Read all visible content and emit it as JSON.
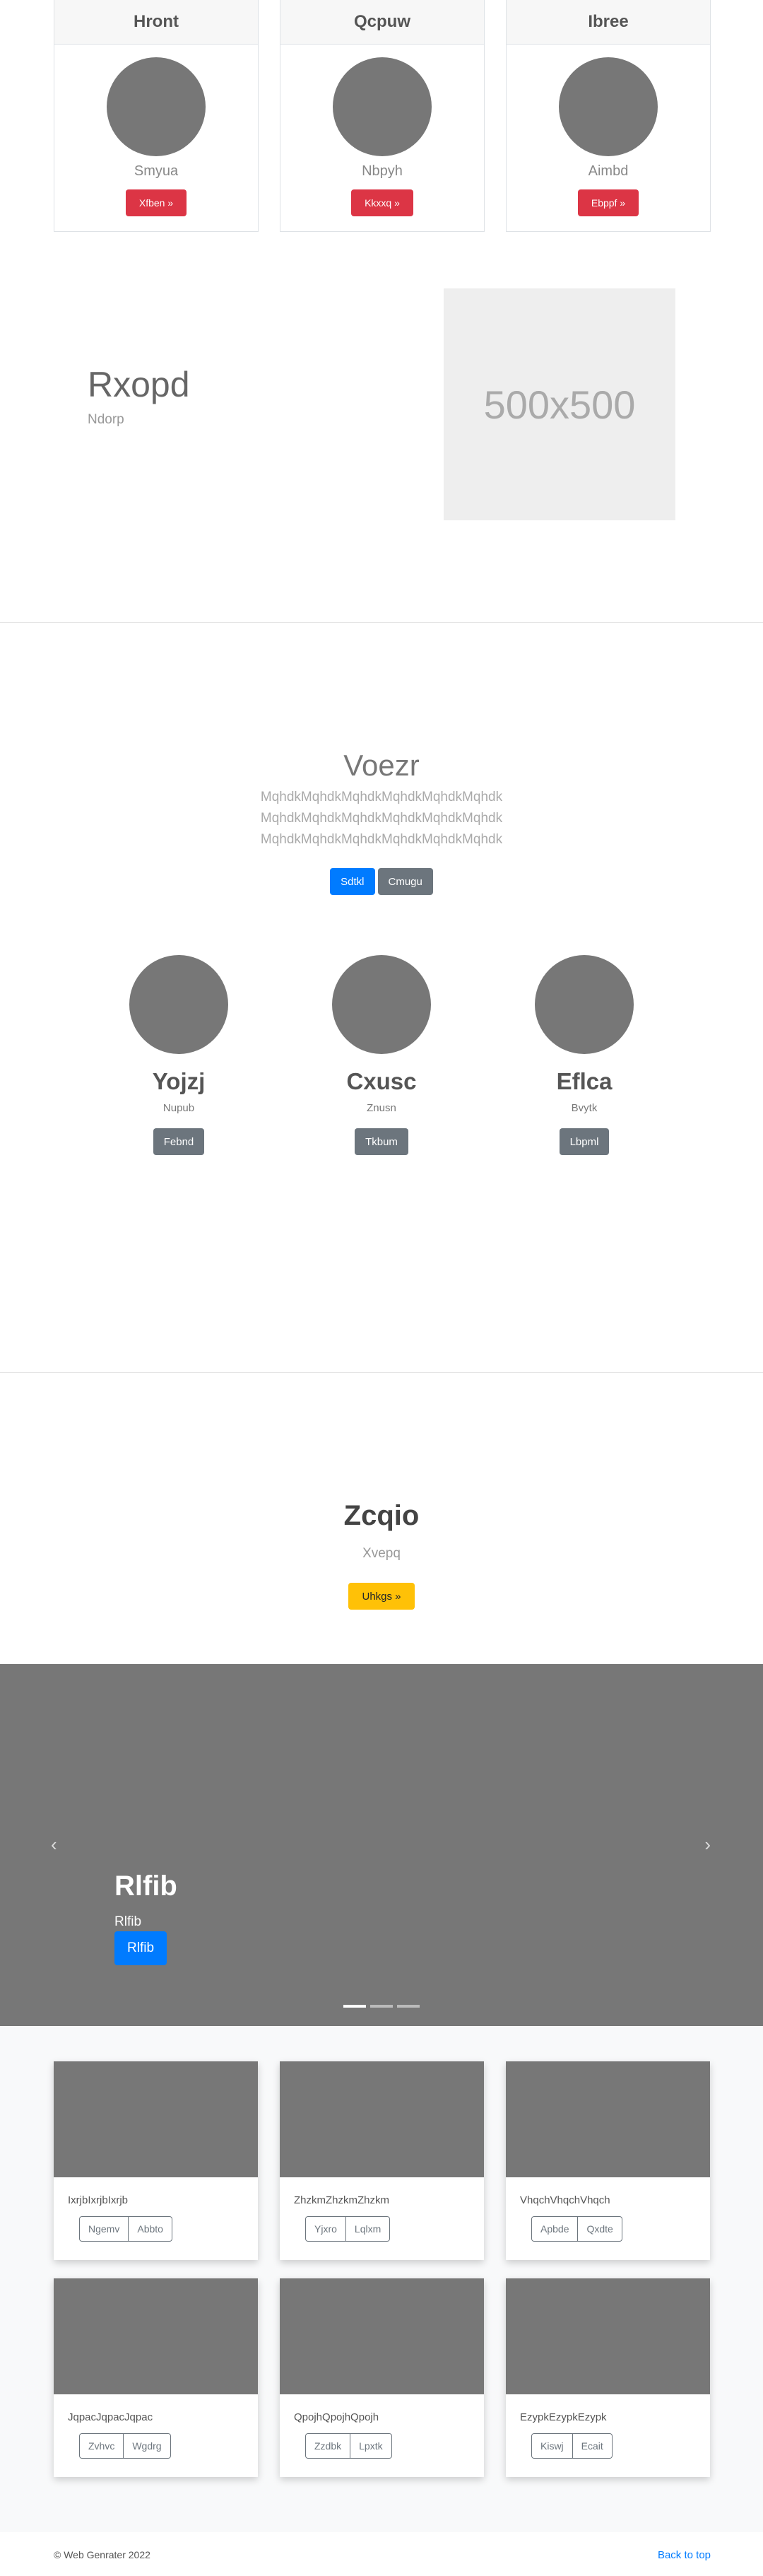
{
  "pricing": [
    {
      "title": "Hront",
      "sub": "Smyua",
      "btn": "Xfben »"
    },
    {
      "title": "Qcpuw",
      "sub": "Nbpyh",
      "btn": "Kkxxq »"
    },
    {
      "title": "Ibree",
      "sub": "Aimbd",
      "btn": "Ebppf »"
    }
  ],
  "hero": {
    "title": "Rxopd",
    "sub": "Ndorp",
    "image_text": "500x500"
  },
  "jumbo": {
    "title": "Voezr",
    "lines": [
      "MqhdkMqhdkMqhdkMqhdkMqhdkMqhdk",
      "MqhdkMqhdkMqhdkMqhdkMqhdkMqhdk",
      "MqhdkMqhdkMqhdkMqhdkMqhdkMqhdk"
    ],
    "primary_btn": "Sdtkl",
    "secondary_btn": "Cmugu"
  },
  "people": [
    {
      "name": "Yojzj",
      "role": "Nupub",
      "btn": "Febnd"
    },
    {
      "name": "Cxusc",
      "role": "Znusn",
      "btn": "Tkbum"
    },
    {
      "name": "Eflca",
      "role": "Bvytk",
      "btn": "Lbpml"
    }
  ],
  "cta": {
    "title": "Zcqio",
    "sub": "Xvepq",
    "btn": "Uhkgs »"
  },
  "carousel": {
    "title": "Rlfib",
    "sub": "Rlfib",
    "btn": "Rlfib",
    "prev": "‹",
    "next": "›"
  },
  "album": [
    {
      "text": "IxrjbIxrjbIxrjb",
      "btn1": "Ngemv",
      "btn2": "Abbto"
    },
    {
      "text": "ZhzkmZhzkmZhzkm",
      "btn1": "Yjxro",
      "btn2": "Lqlxm"
    },
    {
      "text": "VhqchVhqchVhqch",
      "btn1": "Apbde",
      "btn2": "Qxdte"
    },
    {
      "text": "JqpacJqpacJqpac",
      "btn1": "Zvhvc",
      "btn2": "Wgdrg"
    },
    {
      "text": "QpojhQpojhQpojh",
      "btn1": "Zzdbk",
      "btn2": "Lpxtk"
    },
    {
      "text": "EzypkEzypkEzypk",
      "btn1": "Kiswj",
      "btn2": "Ecait"
    }
  ],
  "footer": {
    "copyright": "© Web Genrater 2022",
    "back_to_top": "Back to top"
  }
}
